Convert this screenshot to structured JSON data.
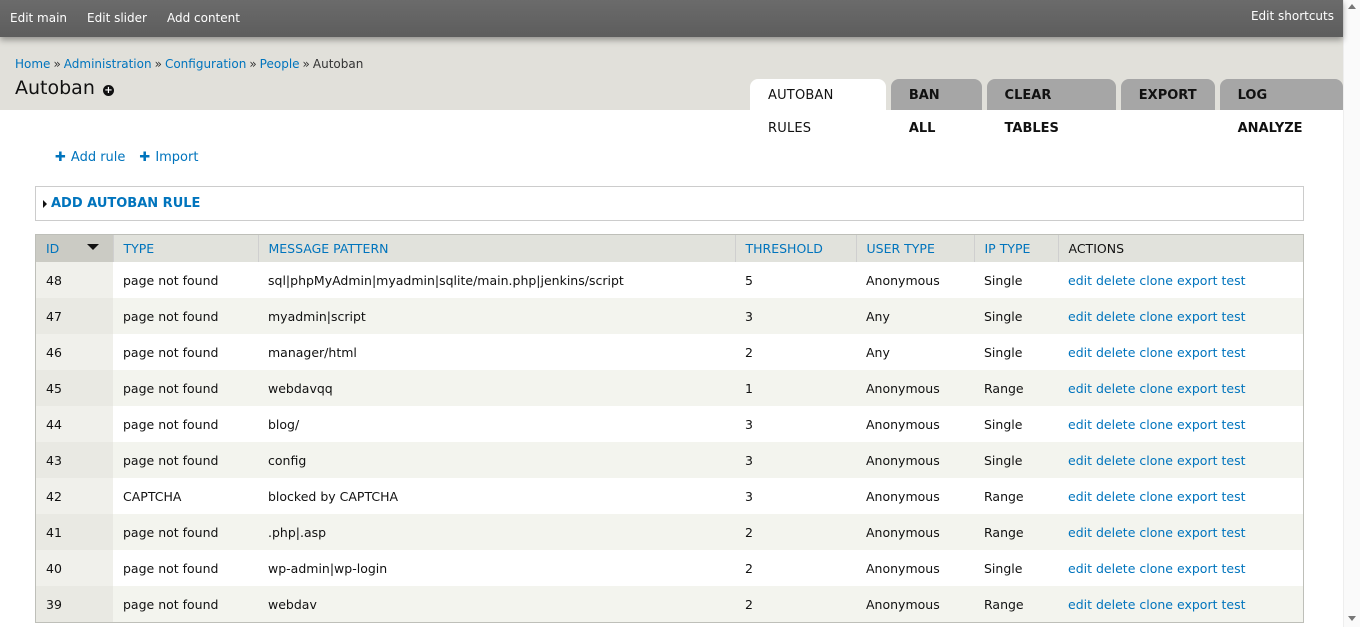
{
  "toolbar": {
    "items": [
      "Edit main",
      "Edit slider",
      "Add content"
    ],
    "right": "Edit shortcuts"
  },
  "breadcrumb": {
    "items": [
      "Home",
      "Administration",
      "Configuration",
      "People"
    ],
    "current": "Autoban",
    "separator": "»"
  },
  "page": {
    "title": "Autoban",
    "shortcut_icon": "+"
  },
  "tabs": [
    "AUTOBAN RULES",
    "BAN ALL",
    "CLEAR TABLES",
    "EXPORT",
    "LOG ANALYZE"
  ],
  "action_links": {
    "add_rule": "Add rule",
    "import": "Import",
    "icon": "plus-icon"
  },
  "fieldset": {
    "legend": "ADD AUTOBAN RULE"
  },
  "table": {
    "headers": [
      "ID",
      "TYPE",
      "MESSAGE PATTERN",
      "THRESHOLD",
      "USER TYPE",
      "IP TYPE",
      "ACTIONS"
    ],
    "ops": [
      "edit",
      "delete",
      "clone",
      "export",
      "test"
    ],
    "rows": [
      {
        "id": "48",
        "type": "page not found",
        "pattern": "sql|phpMyAdmin|myadmin|sqlite/main.php|jenkins/script",
        "threshold": "5",
        "user_type": "Anonymous",
        "ip_type": "Single"
      },
      {
        "id": "47",
        "type": "page not found",
        "pattern": "myadmin|script",
        "threshold": "3",
        "user_type": "Any",
        "ip_type": "Single"
      },
      {
        "id": "46",
        "type": "page not found",
        "pattern": "manager/html",
        "threshold": "2",
        "user_type": "Any",
        "ip_type": "Single"
      },
      {
        "id": "45",
        "type": "page not found",
        "pattern": "webdavqq",
        "threshold": "1",
        "user_type": "Anonymous",
        "ip_type": "Range"
      },
      {
        "id": "44",
        "type": "page not found",
        "pattern": "blog/",
        "threshold": "3",
        "user_type": "Anonymous",
        "ip_type": "Single"
      },
      {
        "id": "43",
        "type": "page not found",
        "pattern": "config",
        "threshold": "3",
        "user_type": "Anonymous",
        "ip_type": "Single"
      },
      {
        "id": "42",
        "type": "CAPTCHA",
        "pattern": "blocked by CAPTCHA",
        "threshold": "3",
        "user_type": "Anonymous",
        "ip_type": "Range"
      },
      {
        "id": "41",
        "type": "page not found",
        "pattern": ".php|.asp",
        "threshold": "2",
        "user_type": "Anonymous",
        "ip_type": "Range"
      },
      {
        "id": "40",
        "type": "page not found",
        "pattern": "wp-admin|wp-login",
        "threshold": "2",
        "user_type": "Anonymous",
        "ip_type": "Single"
      },
      {
        "id": "39",
        "type": "page not found",
        "pattern": "webdav",
        "threshold": "2",
        "user_type": "Anonymous",
        "ip_type": "Range"
      }
    ]
  }
}
